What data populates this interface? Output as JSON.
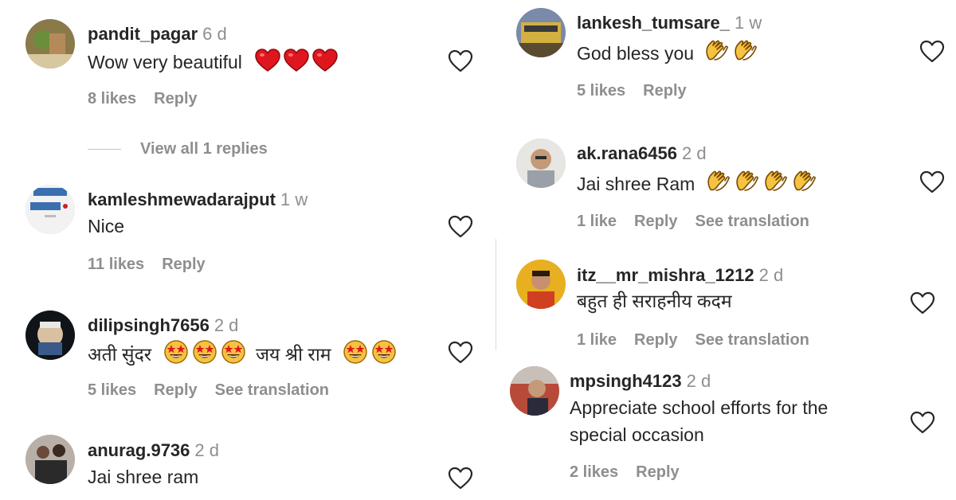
{
  "comments": [
    {
      "user": "pandit_pagar",
      "time": "6 d",
      "text": "Wow very beautiful",
      "likes": "8 likes",
      "reply": "Reply"
    },
    {
      "user": "kamleshmewadarajput",
      "time": "1 w",
      "text": "Nice",
      "likes": "11 likes",
      "reply": "Reply"
    },
    {
      "user": "dilipsingh7656",
      "time": "2 d",
      "text_a": "अती सुंदर",
      "text_b": "जय श्री राम",
      "likes": "5 likes",
      "reply": "Reply",
      "translate": "See translation"
    },
    {
      "user": "anurag.9736",
      "time": "2 d",
      "text": "Jai shree ram"
    },
    {
      "user": "lankesh_tumsare_",
      "time": "1 w",
      "text": "God bless you",
      "likes": "5 likes",
      "reply": "Reply"
    },
    {
      "user": "ak.rana6456",
      "time": "2 d",
      "text": "Jai shree Ram",
      "likes": "1 like",
      "reply": "Reply",
      "translate": "See translation"
    },
    {
      "user": "itz__mr_mishra_1212",
      "time": "2 d",
      "text": "बहुत ही सराहनीय कदम",
      "likes": "1 like",
      "reply": "Reply",
      "translate": "See translation"
    },
    {
      "user": "mpsingh4123",
      "time": "2 d",
      "text": "Appreciate school efforts for the special occasion",
      "likes": "2 likes",
      "reply": "Reply"
    }
  ],
  "view_replies": "View all 1 replies",
  "avatar_badge": "Heart",
  "colors": {
    "text": "#262626",
    "muted": "#8e8e8e",
    "heart_red": "#ed1c24",
    "clap_yellow": "#f5c242"
  }
}
